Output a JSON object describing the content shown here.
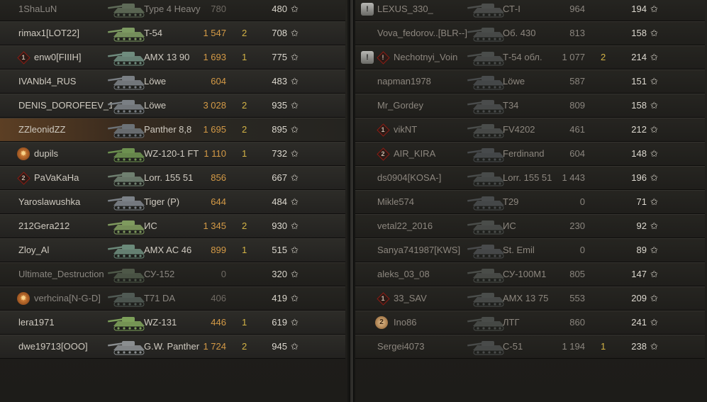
{
  "teams": {
    "left": {
      "players": [
        {
          "badge": null,
          "name": "1ShaLuN",
          "vehicle": "Type 4 Heavy",
          "damage": "780",
          "kills": "",
          "score": "480",
          "state": "dead",
          "dim": true,
          "tank_color": "#5f6b58"
        },
        {
          "badge": null,
          "name": "rimax1[LOT22]",
          "vehicle": "T-54",
          "damage": "1 547",
          "kills": "2",
          "score": "708",
          "state": "alive",
          "dim": false,
          "tank_color": "#7d9a62"
        },
        {
          "badge": "rank",
          "badge_text": "1",
          "name": "enw0[FIIIH]",
          "vehicle": "AMX 13 90",
          "damage": "1 693",
          "kills": "1",
          "score": "775",
          "state": "alive",
          "dim": false,
          "tank_color": "#6f8c7e"
        },
        {
          "badge": null,
          "name": "IVANbl4_RUS",
          "vehicle": "Löwe",
          "damage": "604",
          "kills": "",
          "score": "483",
          "state": "alive",
          "dim": false,
          "tank_color": "#7a7f84"
        },
        {
          "badge": null,
          "name": "DENIS_DOROFEEV_1..",
          "vehicle": "Löwe",
          "damage": "3 028",
          "kills": "2",
          "score": "935",
          "state": "alive",
          "dim": false,
          "tank_color": "#7a7f84"
        },
        {
          "badge": null,
          "name": "ZZleonidZZ",
          "vehicle": "Panther 8,8",
          "damage": "1 695",
          "kills": "2",
          "score": "895",
          "state": "self",
          "dim": false,
          "tank_color": "#6d7277"
        },
        {
          "badge": "gear",
          "badge_text": "✸",
          "name": "dupils",
          "vehicle": "WZ-120-1 FT",
          "damage": "1 110",
          "kills": "1",
          "score": "732",
          "state": "alive",
          "dim": false,
          "tank_color": "#6d9150"
        },
        {
          "badge": "rank",
          "badge_text": "2",
          "name": "PaVaKaHa",
          "vehicle": "Lorr. 155 51",
          "damage": "856",
          "kills": "",
          "score": "667",
          "state": "alive",
          "dim": false,
          "tank_color": "#6f8070"
        },
        {
          "badge": null,
          "name": "Yaroslawushka",
          "vehicle": "Tiger (P)",
          "damage": "644",
          "kills": "",
          "score": "484",
          "state": "alive",
          "dim": false,
          "tank_color": "#7c8288"
        },
        {
          "badge": null,
          "name": "212Gera212",
          "vehicle": "ИС",
          "damage": "1 345",
          "kills": "2",
          "score": "930",
          "state": "alive",
          "dim": false,
          "tank_color": "#7f9a5e"
        },
        {
          "badge": null,
          "name": "Zloy_Al",
          "vehicle": "AMX AC 46",
          "damage": "899",
          "kills": "1",
          "score": "515",
          "state": "alive",
          "dim": false,
          "tank_color": "#6b8a7a"
        },
        {
          "badge": null,
          "name": "Ultimate_Destruction",
          "vehicle": "СУ-152",
          "damage": "0",
          "kills": "",
          "score": "320",
          "state": "dead",
          "dim": true,
          "tank_color": "#4e5848"
        },
        {
          "badge": "gear",
          "badge_text": "✸",
          "name": "verhcina[N-G-D]",
          "vehicle": "T71 DA",
          "damage": "406",
          "kills": "",
          "score": "419",
          "state": "dead",
          "dim": true,
          "tank_color": "#505a54"
        },
        {
          "badge": null,
          "name": "lera1971",
          "vehicle": "WZ-131",
          "damage": "446",
          "kills": "1",
          "score": "619",
          "state": "alive",
          "dim": false,
          "tank_color": "#7da05a"
        },
        {
          "badge": null,
          "name": "dwe19713[OOO]",
          "vehicle": "G.W. Panther",
          "damage": "1 724",
          "kills": "2",
          "score": "945",
          "state": "alive",
          "dim": false,
          "tank_color": "#8a8e90"
        }
      ]
    },
    "right": {
      "players": [
        {
          "badge": "shield",
          "badge_text": "!",
          "name": "LEXUS_330_",
          "vehicle": "СТ-I",
          "damage": "964",
          "kills": "",
          "score": "194",
          "state": "dead",
          "tank_color": "#4c4e4c"
        },
        {
          "badge": null,
          "name": "Vova_fedorov..[BLR--]",
          "vehicle": "Об. 430",
          "damage": "813",
          "kills": "",
          "score": "158",
          "state": "dead",
          "tank_color": "#4a4d4b"
        },
        {
          "badge": "shield2",
          "badge_text": "!",
          "name": "Nechotnyi_Voin",
          "vehicle": "Т-54 обл.",
          "damage": "1 077",
          "kills": "2",
          "score": "214",
          "state": "dead",
          "tank_color": "#4a4d4b"
        },
        {
          "badge": null,
          "name": "napman1978",
          "vehicle": "Löwe",
          "damage": "587",
          "kills": "",
          "score": "151",
          "state": "dead",
          "tank_color": "#484b4c"
        },
        {
          "badge": null,
          "name": "Mr_Gordey",
          "vehicle": "T34",
          "damage": "809",
          "kills": "",
          "score": "158",
          "state": "dead",
          "tank_color": "#4a4c4c"
        },
        {
          "badge": "rank",
          "badge_text": "1",
          "name": "vikNT",
          "vehicle": "FV4202",
          "damage": "461",
          "kills": "",
          "score": "212",
          "state": "dead",
          "tank_color": "#4a4d4b"
        },
        {
          "badge": "rank",
          "badge_text": "2",
          "name": "AIR_KIRA",
          "vehicle": "Ferdinand",
          "damage": "604",
          "kills": "",
          "score": "148",
          "state": "dead",
          "tank_color": "#474a4c"
        },
        {
          "badge": null,
          "name": "ds0904[KOSA-]",
          "vehicle": "Lorr. 155 51",
          "damage": "1 443",
          "kills": "",
          "score": "196",
          "state": "dead",
          "tank_color": "#484b4a"
        },
        {
          "badge": null,
          "name": "Mikle574",
          "vehicle": "T29",
          "damage": "0",
          "kills": "",
          "score": "71",
          "state": "dead",
          "tank_color": "#484b4c"
        },
        {
          "badge": null,
          "name": "vetal22_2016",
          "vehicle": "ИС",
          "damage": "230",
          "kills": "",
          "score": "92",
          "state": "dead",
          "tank_color": "#4a4d4a"
        },
        {
          "badge": null,
          "name": "Sanya741987[KWS]",
          "vehicle": "St. Emil",
          "damage": "0",
          "kills": "",
          "score": "89",
          "state": "dead",
          "tank_color": "#494b4c"
        },
        {
          "badge": null,
          "name": "aleks_03_08",
          "vehicle": "СУ-100М1",
          "damage": "805",
          "kills": "",
          "score": "147",
          "state": "dead",
          "tank_color": "#4a4d49"
        },
        {
          "badge": "rank",
          "badge_text": "1",
          "name": "33_SAV",
          "vehicle": "AMX 13 75",
          "damage": "553",
          "kills": "",
          "score": "209",
          "state": "dead",
          "tank_color": "#4a4d4b"
        },
        {
          "badge": "coin",
          "badge_text": "2",
          "name": "Ino86",
          "vehicle": "ЛТГ",
          "damage": "860",
          "kills": "",
          "score": "241",
          "state": "dead",
          "tank_color": "#494c49"
        },
        {
          "badge": null,
          "name": "Sergei4073",
          "vehicle": "С-51",
          "damage": "1 194",
          "kills": "1",
          "score": "238",
          "state": "dead",
          "tank_color": "#494b4a"
        }
      ]
    }
  },
  "icons": {
    "star": "star-icon",
    "rank_badge": "rank-diamond-icon",
    "gear_badge": "gear-medal-icon",
    "shield_badge": "shield-icon",
    "coin_badge": "coin-medal-icon",
    "tank": "tank-silhouette-icon"
  }
}
